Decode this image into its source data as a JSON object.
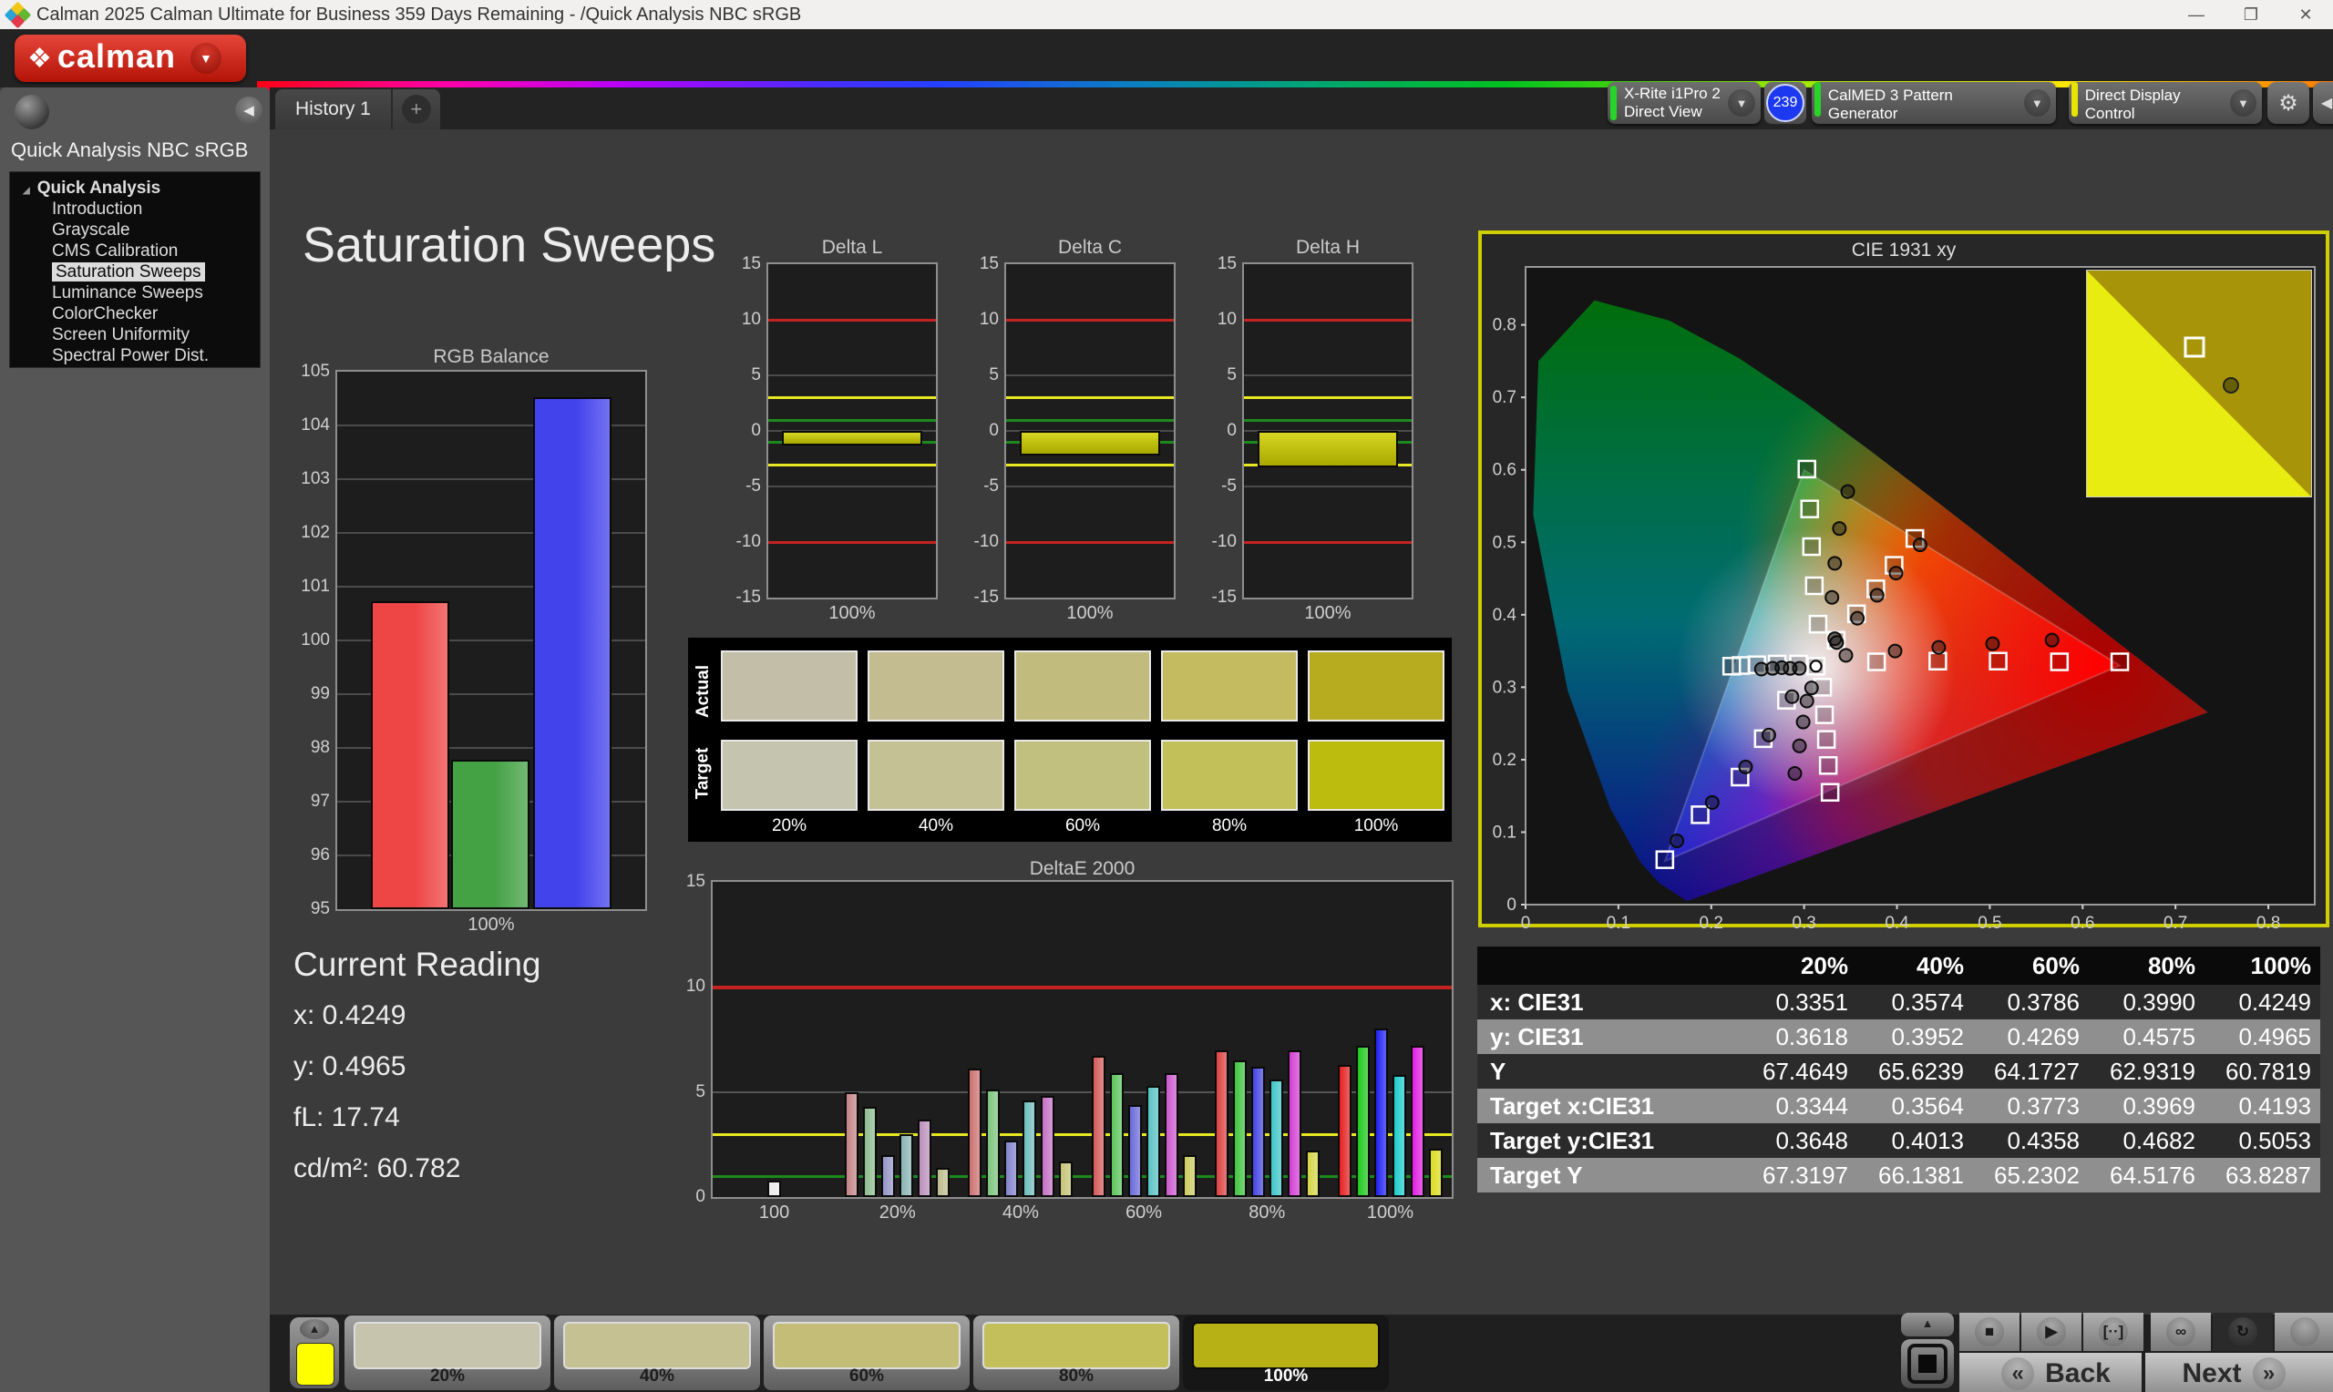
{
  "titlebar": {
    "title": "Calman 2025 Calman Ultimate for Business 359 Days Remaining  - /Quick Analysis NBC sRGB",
    "minimize": "—",
    "maximize": "❐",
    "close": "✕"
  },
  "logo": {
    "word": "calman",
    "glyph": "❖",
    "dropdown": "▼"
  },
  "tabs": {
    "history": "History 1",
    "add": "+"
  },
  "device_bar": {
    "meter_line1": "X-Rite i1Pro 2",
    "meter_line2": "Direct View",
    "meter_status_color": "#27d427",
    "badge": "239",
    "pattern_generator": "CalMED 3 Pattern Generator",
    "pattern_status_color": "#27d427",
    "display_control": "Direct Display Control",
    "display_status_color": "#e8e400",
    "gear": "⚙",
    "collapse": "◀",
    "arrow": "▼"
  },
  "sidebar": {
    "header": "Quick Analysis NBC sRGB",
    "root": "Quick Analysis",
    "expander": "◢",
    "collapse_arrow": "◀",
    "items": [
      "Introduction",
      "Grayscale",
      "CMS Calibration",
      "Saturation Sweeps",
      "Luminance Sweeps",
      "ColorChecker",
      "Screen Uniformity",
      "Spectral Power Dist."
    ],
    "selected": "Saturation Sweeps"
  },
  "page_title": "Saturation Sweeps",
  "current_reading": {
    "title": "Current Reading",
    "lines": [
      "x: 0.4249",
      "y: 0.4965",
      "fL: 17.74",
      "cd/m²: 60.782"
    ]
  },
  "swatch_panel": {
    "row_labels": [
      "Actual",
      "Target"
    ],
    "col_labels": [
      "20%",
      "40%",
      "60%",
      "80%",
      "100%"
    ],
    "actual_colors": [
      "#c3bea7",
      "#c3bc90",
      "#c1bb7d",
      "#c4ba60",
      "#b7ab1f"
    ],
    "target_colors": [
      "#c5c4ae",
      "#c4c194",
      "#c2c07e",
      "#c2c059",
      "#bcbc0e"
    ]
  },
  "table": {
    "columns": [
      "20%",
      "40%",
      "60%",
      "80%",
      "100%"
    ],
    "rows": [
      {
        "label": "x: CIE31",
        "values": [
          "0.3351",
          "0.3574",
          "0.3786",
          "0.3990",
          "0.4249"
        ],
        "shade": "dark"
      },
      {
        "label": "y: CIE31",
        "values": [
          "0.3618",
          "0.3952",
          "0.4269",
          "0.4575",
          "0.4965"
        ],
        "shade": "light"
      },
      {
        "label": "Y",
        "values": [
          "67.4649",
          "65.6239",
          "64.1727",
          "62.9319",
          "60.7819"
        ],
        "shade": "dark"
      },
      {
        "label": "Target x:CIE31",
        "values": [
          "0.3344",
          "0.3564",
          "0.3773",
          "0.3969",
          "0.4193"
        ],
        "shade": "light"
      },
      {
        "label": "Target y:CIE31",
        "values": [
          "0.3648",
          "0.4013",
          "0.4358",
          "0.4682",
          "0.5053"
        ],
        "shade": "dark"
      },
      {
        "label": "Target Y",
        "values": [
          "67.3197",
          "66.1381",
          "65.2302",
          "64.5176",
          "63.8287"
        ],
        "shade": "light"
      }
    ]
  },
  "chart_data": [
    {
      "id": "rgb_balance",
      "type": "bar",
      "title": "RGB Balance",
      "categories": [
        "Red",
        "Green",
        "Blue"
      ],
      "values": [
        100.73,
        97.78,
        104.52
      ],
      "colors": [
        "#ee4545",
        "#44a144",
        "#4343ec"
      ],
      "xlabel": "100%",
      "ylim": [
        95,
        105
      ],
      "ytick_step": 1
    },
    {
      "id": "delta_l",
      "type": "bar",
      "title": "Delta L",
      "values": [
        -1.3
      ],
      "xlabel": "100%",
      "ylim": [
        -15,
        15
      ],
      "yticks": [
        -15,
        -10,
        -5,
        0,
        5,
        10,
        15
      ],
      "limit_red": 10,
      "limit_yellow": 3,
      "limit_green": 1,
      "bar_color": "#d6d622"
    },
    {
      "id": "delta_c",
      "type": "bar",
      "title": "Delta C",
      "values": [
        -2.2
      ],
      "xlabel": "100%",
      "ylim": [
        -15,
        15
      ],
      "yticks": [
        -15,
        -10,
        -5,
        0,
        5,
        10,
        15
      ],
      "limit_red": 10,
      "limit_yellow": 3,
      "limit_green": 1,
      "bar_color": "#d6d622"
    },
    {
      "id": "delta_h",
      "type": "bar",
      "title": "Delta H",
      "values": [
        -3.3
      ],
      "xlabel": "100%",
      "ylim": [
        -15,
        15
      ],
      "yticks": [
        -15,
        -10,
        -5,
        0,
        5,
        10,
        15
      ],
      "limit_red": 10,
      "limit_yellow": 3,
      "limit_green": 1,
      "bar_color": "#d6d622"
    },
    {
      "id": "deltae2000",
      "type": "bar",
      "title": "DeltaE 2000",
      "ylim": [
        0,
        15
      ],
      "yticks": [
        0,
        5,
        10,
        15
      ],
      "limit_red": 10,
      "limit_yellow": 3,
      "limit_green": 1,
      "groups": [
        {
          "label": "100",
          "values": [
            0.8
          ],
          "colors": [
            "#ececec"
          ]
        },
        {
          "label": "20%",
          "values": [
            5.0,
            4.3,
            2.0,
            3.0,
            3.7,
            1.4
          ],
          "colors": [
            "#c48484",
            "#8fbc8f",
            "#9494c6",
            "#8ab4b4",
            "#bc90bc",
            "#bcbc8e"
          ]
        },
        {
          "label": "40%",
          "values": [
            6.1,
            5.1,
            2.7,
            4.6,
            4.8,
            1.7
          ],
          "colors": [
            "#cc7070",
            "#7cc47c",
            "#8282cc",
            "#70bcbc",
            "#c470c4",
            "#c4c476"
          ]
        },
        {
          "label": "60%",
          "values": [
            6.7,
            5.9,
            4.4,
            5.3,
            5.9,
            2.0
          ],
          "colors": [
            "#d45a5a",
            "#5cc45c",
            "#6a6ad8",
            "#58c2c2",
            "#cc58cc",
            "#cccc5e"
          ]
        },
        {
          "label": "80%",
          "values": [
            7.0,
            6.5,
            6.2,
            5.6,
            7.0,
            2.2
          ],
          "colors": [
            "#dc4242",
            "#40c440",
            "#4444e2",
            "#3ec6c6",
            "#d43ed4",
            "#d4d446"
          ]
        },
        {
          "label": "100%",
          "values": [
            6.3,
            7.2,
            8.0,
            5.8,
            7.2,
            2.3
          ],
          "colors": [
            "#e42020",
            "#1ec81e",
            "#2020f2",
            "#1ecccc",
            "#e01ee0",
            "#dcdc20"
          ]
        }
      ]
    },
    {
      "id": "cie_1931",
      "type": "scatter",
      "title": "CIE 1931 xy",
      "xlim": [
        0,
        0.8
      ],
      "ylim": [
        0,
        0.8
      ],
      "tick_step": 0.1,
      "white_point": [
        0.3127,
        0.329
      ],
      "targets": {
        "red": [
          [
            0.378,
            0.335
          ],
          [
            0.444,
            0.336
          ],
          [
            0.509,
            0.336
          ],
          [
            0.575,
            0.335
          ],
          [
            0.64,
            0.335
          ]
        ],
        "green": [
          [
            0.315,
            0.387
          ],
          [
            0.311,
            0.44
          ],
          [
            0.308,
            0.494
          ],
          [
            0.306,
            0.546
          ],
          [
            0.303,
            0.601
          ]
        ],
        "blue": [
          [
            0.281,
            0.282
          ],
          [
            0.256,
            0.229
          ],
          [
            0.231,
            0.176
          ],
          [
            0.188,
            0.124
          ],
          [
            0.15,
            0.062
          ]
        ],
        "cyan": [
          [
            0.294,
            0.332
          ],
          [
            0.271,
            0.332
          ],
          [
            0.249,
            0.331
          ],
          [
            0.232,
            0.33
          ],
          [
            0.222,
            0.329
          ]
        ],
        "magenta": [
          [
            0.32,
            0.3
          ],
          [
            0.322,
            0.262
          ],
          [
            0.324,
            0.228
          ],
          [
            0.326,
            0.192
          ],
          [
            0.328,
            0.155
          ]
        ],
        "yellow": [
          [
            0.3344,
            0.3648
          ],
          [
            0.3564,
            0.4013
          ],
          [
            0.3773,
            0.4358
          ],
          [
            0.3969,
            0.4682
          ],
          [
            0.4193,
            0.5053
          ]
        ]
      },
      "measured": {
        "red": [
          [
            0.345,
            0.344
          ],
          [
            0.398,
            0.35
          ],
          [
            0.445,
            0.355
          ],
          [
            0.503,
            0.36
          ],
          [
            0.567,
            0.365
          ]
        ],
        "green": [
          [
            0.333,
            0.367
          ],
          [
            0.33,
            0.424
          ],
          [
            0.333,
            0.471
          ],
          [
            0.338,
            0.519
          ],
          [
            0.347,
            0.57
          ]
        ],
        "blue": [
          [
            0.287,
            0.287
          ],
          [
            0.262,
            0.234
          ],
          [
            0.237,
            0.19
          ],
          [
            0.201,
            0.141
          ],
          [
            0.163,
            0.088
          ]
        ],
        "cyan": [
          [
            0.295,
            0.326
          ],
          [
            0.285,
            0.326
          ],
          [
            0.276,
            0.327
          ],
          [
            0.266,
            0.326
          ],
          [
            0.254,
            0.325
          ]
        ],
        "magenta": [
          [
            0.308,
            0.299
          ],
          [
            0.303,
            0.281
          ],
          [
            0.299,
            0.252
          ],
          [
            0.295,
            0.219
          ],
          [
            0.29,
            0.181
          ]
        ],
        "yellow": [
          [
            0.3351,
            0.3618
          ],
          [
            0.3574,
            0.3952
          ],
          [
            0.3786,
            0.4269
          ],
          [
            0.399,
            0.4575
          ],
          [
            0.4249,
            0.4965
          ]
        ]
      }
    }
  ],
  "bottom_bar": {
    "preview_color": "#ffff00",
    "preview_up": "▲",
    "patterns": [
      {
        "label": "20%",
        "color": "#c6c4ad"
      },
      {
        "label": "40%",
        "color": "#c5c192"
      },
      {
        "label": "60%",
        "color": "#c3bd78"
      },
      {
        "label": "80%",
        "color": "#c3bf5b"
      },
      {
        "label": "100%",
        "color": "#b7b116"
      }
    ],
    "selected_pattern": "100%",
    "transport": [
      {
        "name": "stop",
        "glyph": "■"
      },
      {
        "name": "play",
        "glyph": "▶"
      },
      {
        "name": "pattern-window",
        "glyph": "[··]"
      },
      {
        "name": "continuous",
        "glyph": "∞"
      },
      {
        "name": "sync",
        "glyph": "↻",
        "active": true
      },
      {
        "name": "blank",
        "glyph": ""
      }
    ],
    "back": "Back",
    "next": "Next",
    "back_chevron": "«",
    "next_chevron": "»"
  }
}
